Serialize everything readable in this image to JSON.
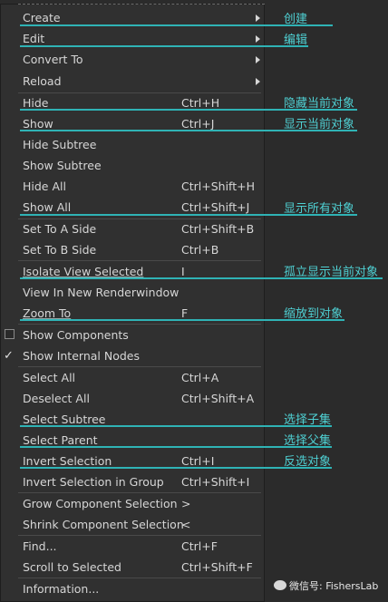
{
  "menu": {
    "items": [
      {
        "label": "Create",
        "shortcut": "",
        "submenu": true
      },
      {
        "label": "Edit",
        "shortcut": "",
        "submenu": true
      },
      {
        "label": "Convert To",
        "shortcut": "",
        "submenu": true
      },
      {
        "label": "Reload",
        "shortcut": "",
        "submenu": true
      },
      {
        "label": "Hide",
        "shortcut": "Ctrl+H"
      },
      {
        "label": "Show",
        "shortcut": "Ctrl+J"
      },
      {
        "label": "Hide Subtree",
        "shortcut": ""
      },
      {
        "label": "Show Subtree",
        "shortcut": ""
      },
      {
        "label": "Hide All",
        "shortcut": "Ctrl+Shift+H"
      },
      {
        "label": "Show All",
        "shortcut": "Ctrl+Shift+J"
      },
      {
        "label": "Set To A Side",
        "shortcut": "Ctrl+Shift+B"
      },
      {
        "label": "Set To B Side",
        "shortcut": "Ctrl+B"
      },
      {
        "label": "Isolate View Selected",
        "shortcut": "I"
      },
      {
        "label": "View In New Renderwindow",
        "shortcut": ""
      },
      {
        "label": "Zoom To",
        "shortcut": "F"
      },
      {
        "label": "Show Components",
        "shortcut": "",
        "checkbox": true,
        "checked": false
      },
      {
        "label": "Show Internal Nodes",
        "shortcut": "",
        "checkbox": true,
        "checked": true
      },
      {
        "label": "Select All",
        "shortcut": "Ctrl+A"
      },
      {
        "label": "Deselect All",
        "shortcut": "Ctrl+Shift+A"
      },
      {
        "label": "Select Subtree",
        "shortcut": ""
      },
      {
        "label": "Select Parent",
        "shortcut": ""
      },
      {
        "label": "Invert Selection",
        "shortcut": "Ctrl+I"
      },
      {
        "label": "Invert Selection in Group",
        "shortcut": "Ctrl+Shift+I"
      },
      {
        "label": "Grow Component Selection",
        "shortcut": ">"
      },
      {
        "label": "Shrink Component Selection",
        "shortcut": "<"
      },
      {
        "label": "Find...",
        "shortcut": "Ctrl+F"
      },
      {
        "label": "Scroll to Selected",
        "shortcut": "Ctrl+Shift+F"
      },
      {
        "label": "Information...",
        "shortcut": ""
      }
    ]
  },
  "annotations": {
    "create": "创建",
    "edit": "编辑",
    "hide": "隐藏当前对象",
    "show": "显示当前对象",
    "show_all": "显示所有对象",
    "isolate": "孤立显示当前对象",
    "zoom": "缩放到对象",
    "select_subtree": "选择子集",
    "select_parent": "选择父集",
    "invert": "反选对象"
  },
  "watermark": "微信号: FishersLab",
  "colors": {
    "annotation": "#2fb3b5",
    "menu_bg": "#303030",
    "text": "#d6d6d6"
  }
}
